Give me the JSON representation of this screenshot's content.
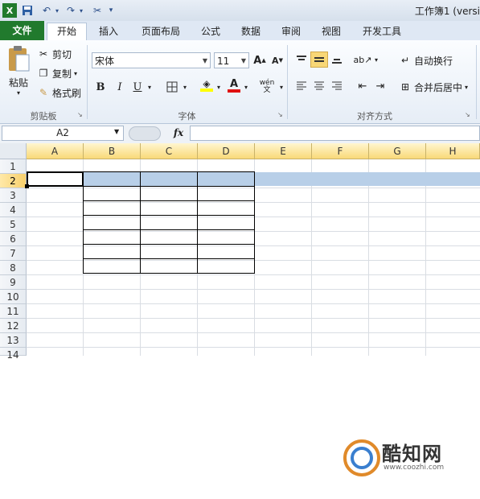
{
  "titlebar": {
    "document_title": "工作簿1 (versi",
    "quick_access": [
      "excel-logo-icon",
      "save-icon",
      "undo-icon",
      "redo-icon",
      "tools-icon",
      "customize-icon"
    ]
  },
  "tabs": {
    "file": "文件",
    "items": [
      "开始",
      "插入",
      "页面布局",
      "公式",
      "数据",
      "审阅",
      "视图",
      "开发工具"
    ]
  },
  "ribbon": {
    "clipboard": {
      "paste": "粘贴",
      "cut": "剪切",
      "copy": "复制",
      "format_painter": "格式刷",
      "label": "剪贴板"
    },
    "font": {
      "font_name": "宋体",
      "font_size": "11",
      "grow": "A",
      "shrink": "A",
      "bold": "B",
      "italic": "I",
      "underline": "U",
      "font_color_letter": "A",
      "phonetic": "wén",
      "label": "字体"
    },
    "alignment": {
      "wrap_text": "自动换行",
      "merge_center": "合并后居中",
      "label": "对齐方式"
    },
    "accent_color": "#217a2d"
  },
  "formula_bar": {
    "name_box": "A2",
    "fx": "fx",
    "content": ""
  },
  "sheet": {
    "columns": [
      "A",
      "B",
      "C",
      "D",
      "E",
      "F",
      "G",
      "H"
    ],
    "rows": [
      "1",
      "2",
      "3",
      "4",
      "5",
      "6",
      "7",
      "8",
      "9",
      "10",
      "11",
      "12",
      "13",
      "14"
    ],
    "active_cell": "A2",
    "selected_row": "2",
    "bordered_range": "B2:D8"
  },
  "watermark": {
    "brand": "酷知网",
    "url": "www.coozhi.com"
  }
}
